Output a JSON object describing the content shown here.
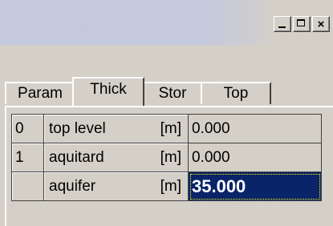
{
  "window": {
    "minimize_icon": "minimize-icon",
    "maximize_icon": "maximize-icon",
    "close_label": "×"
  },
  "tabs": [
    {
      "label": "Param",
      "active": false
    },
    {
      "label": "Thick",
      "active": true
    },
    {
      "label": "Stor",
      "active": false
    },
    {
      "label": "Top",
      "active": false
    }
  ],
  "grid": {
    "rows": [
      {
        "index": "0",
        "name": "top level",
        "unit": "[m]",
        "value": "0.000",
        "selected": false
      },
      {
        "index": "1",
        "name": "aquitard",
        "unit": "[m]",
        "value": "0.000",
        "selected": false
      },
      {
        "index": "",
        "name": "aquifer",
        "unit": "[m]",
        "value": "35.000",
        "selected": true
      }
    ]
  },
  "colors": {
    "face": "#d4d0c8",
    "selection": "#0a246a"
  }
}
